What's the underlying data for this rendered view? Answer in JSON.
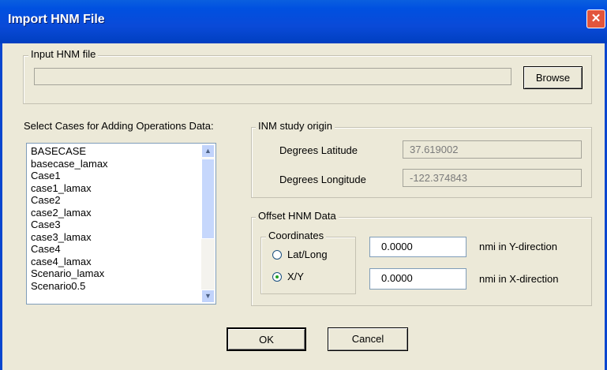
{
  "window": {
    "title": "Import HNM File",
    "close_glyph": "✕"
  },
  "input_group": {
    "legend": "Input HNM file",
    "path_value": "",
    "browse_label": "Browse"
  },
  "cases": {
    "label": "Select Cases for Adding Operations Data:",
    "items": [
      "BASECASE",
      "basecase_lamax",
      "Case1",
      "case1_lamax",
      "Case2",
      "case2_lamax",
      "Case3",
      "case3_lamax",
      "Case4",
      "case4_lamax",
      "Scenario_lamax",
      "Scenario0.5"
    ]
  },
  "origin": {
    "legend": "INM study origin",
    "lat_label": "Degrees Latitude",
    "lat_value": "37.619002",
    "lon_label": "Degrees Longitude",
    "lon_value": "-122.374843"
  },
  "offset": {
    "legend": "Offset HNM Data",
    "coords_legend": "Coordinates",
    "opt_latlong": "Lat/Long",
    "opt_xy": "X/Y",
    "selected": "X/Y",
    "y_value": "0.0000",
    "y_label": "nmi in Y-direction",
    "x_value": "0.0000",
    "x_label": "nmi in X-direction"
  },
  "buttons": {
    "ok": "OK",
    "cancel": "Cancel"
  }
}
